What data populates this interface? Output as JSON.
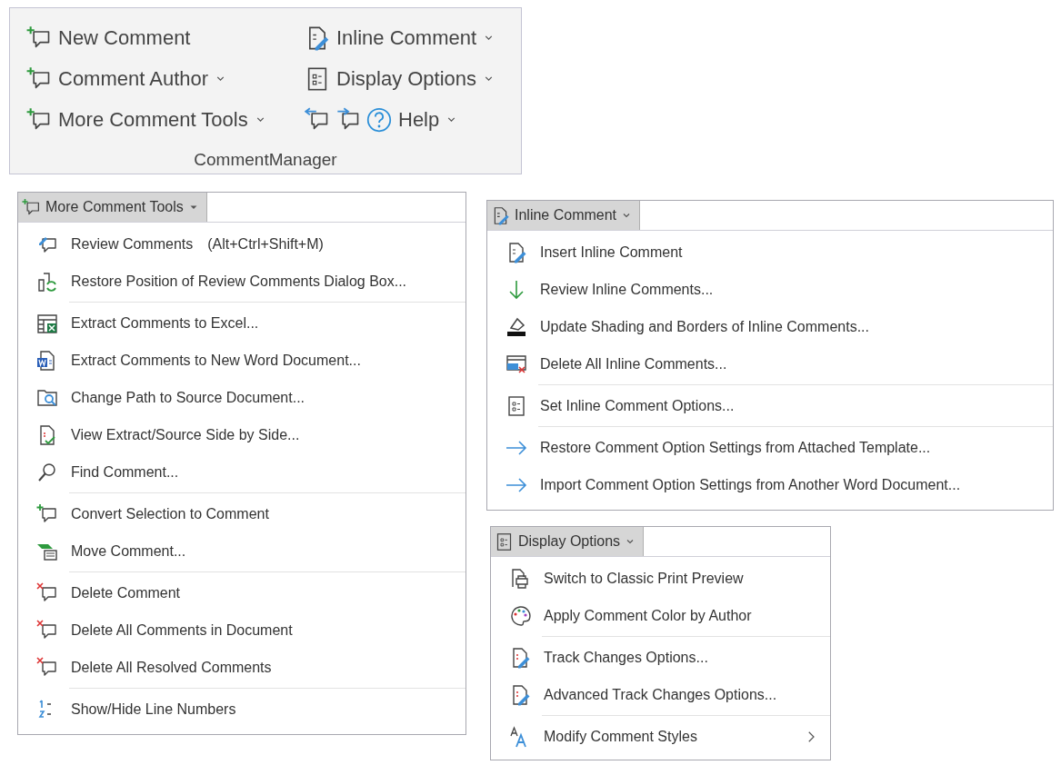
{
  "ribbon": {
    "group_label": "CommentManager",
    "columns": [
      [
        [
          {
            "kind": "labeled",
            "label": "New Comment",
            "dropdown": false
          }
        ],
        [
          {
            "kind": "labeled",
            "label": "Comment Author",
            "dropdown": true
          }
        ],
        [
          {
            "kind": "labeled",
            "label": "More Comment Tools",
            "dropdown": true
          }
        ]
      ],
      [
        [
          {
            "kind": "labeled",
            "label": "Inline Comment",
            "dropdown": true
          }
        ],
        [
          {
            "kind": "labeled",
            "label": "Display Options",
            "dropdown": true
          }
        ],
        [
          {
            "kind": "icon-only",
            "dropdown": false
          },
          {
            "kind": "icon-only",
            "dropdown": false
          },
          {
            "kind": "labeled",
            "label": "Help",
            "dropdown": true
          }
        ]
      ]
    ]
  },
  "menus": [
    {
      "title": "More Comment Tools",
      "items": [
        {
          "label": "Review Comments",
          "shortcut": "(Alt+Ctrl+Shift+M)",
          "separator_above": false,
          "submenu": false
        },
        {
          "label": "Restore Position of Review Comments Dialog Box...",
          "separator_above": false,
          "submenu": false
        },
        {
          "label": "Extract Comments to Excel...",
          "separator_above": true,
          "submenu": false
        },
        {
          "label": "Extract Comments to New Word Document...",
          "separator_above": false,
          "submenu": false
        },
        {
          "label": "Change Path to Source Document...",
          "separator_above": false,
          "submenu": false
        },
        {
          "label": "View Extract/Source Side by Side...",
          "separator_above": false,
          "submenu": false
        },
        {
          "label": "Find Comment...",
          "separator_above": false,
          "submenu": false
        },
        {
          "label": "Convert Selection to Comment",
          "separator_above": true,
          "submenu": false
        },
        {
          "label": "Move Comment...",
          "separator_above": false,
          "submenu": false
        },
        {
          "label": "Delete Comment",
          "separator_above": true,
          "submenu": false
        },
        {
          "label": "Delete All Comments in Document",
          "separator_above": false,
          "submenu": false
        },
        {
          "label": "Delete All Resolved Comments",
          "separator_above": false,
          "submenu": false
        },
        {
          "label": "Show/Hide Line Numbers",
          "separator_above": true,
          "submenu": false
        }
      ]
    },
    {
      "title": "Inline Comment",
      "items": [
        {
          "label": "Insert Inline Comment",
          "separator_above": false,
          "submenu": false
        },
        {
          "label": "Review Inline Comments...",
          "separator_above": false,
          "submenu": false
        },
        {
          "label": "Update Shading and Borders of Inline Comments...",
          "separator_above": false,
          "submenu": false
        },
        {
          "label": "Delete All Inline Comments...",
          "separator_above": false,
          "submenu": false
        },
        {
          "label": "Set Inline Comment Options...",
          "separator_above": true,
          "submenu": false
        },
        {
          "label": "Restore Comment Option Settings from Attached Template...",
          "separator_above": true,
          "submenu": false
        },
        {
          "label": "Import Comment Option Settings from Another Word Document...",
          "separator_above": false,
          "submenu": false
        }
      ]
    },
    {
      "title": "Display Options",
      "items": [
        {
          "label": "Switch to Classic Print Preview",
          "separator_above": false,
          "submenu": false
        },
        {
          "label": "Apply Comment Color by Author",
          "separator_above": false,
          "submenu": false
        },
        {
          "label": "Track Changes Options...",
          "separator_above": true,
          "submenu": false
        },
        {
          "label": "Advanced Track Changes Options...",
          "separator_above": false,
          "submenu": false
        },
        {
          "label": "Modify Comment Styles",
          "separator_above": true,
          "submenu": true
        }
      ]
    }
  ]
}
